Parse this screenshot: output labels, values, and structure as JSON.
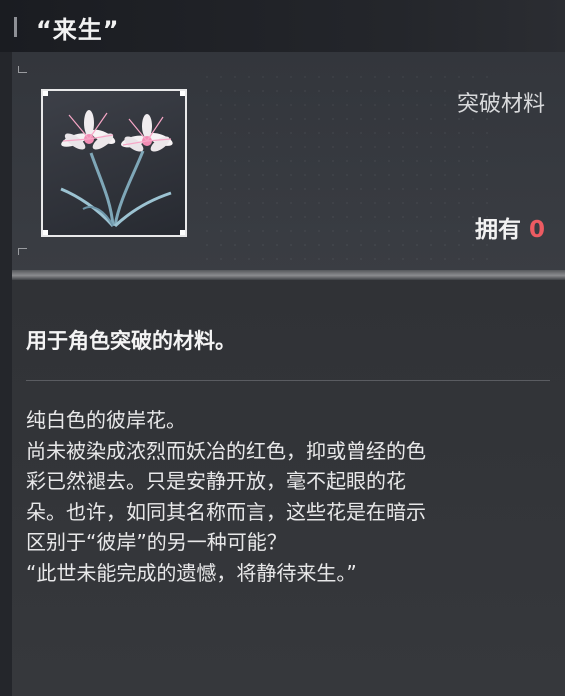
{
  "item": {
    "title": "“来生”",
    "category": "突破材料",
    "owned_label": "拥有",
    "owned_count": "0",
    "image_icon": "white-spider-lily-icon"
  },
  "description": {
    "summary": "用于角色突破的材料。",
    "lines": [
      "纯白色的彼岸花。",
      "尚未被染成浓烈而妖冶的红色，抑或曾经的色",
      "彩已然褪去。只是安静开放，毫不起眼的花",
      "朵。也许，如同其名称而言，这些花是在暗示",
      "区别于“彼岸”的另一种可能？",
      "“此世未能完成的遗憾，将静待来生。”"
    ]
  },
  "colors": {
    "accent_red": "#ec5b62",
    "text_primary": "#f2f2f2"
  }
}
